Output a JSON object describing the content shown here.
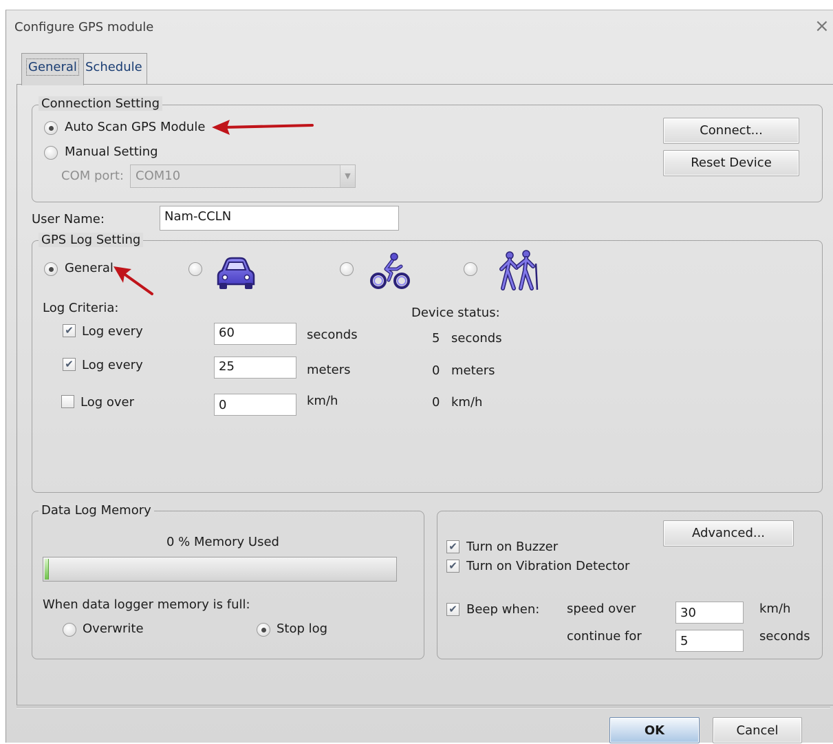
{
  "window": {
    "title": "Configure GPS module",
    "close_icon": "×"
  },
  "tabs": [
    {
      "label": "General"
    },
    {
      "label": "Schedule"
    }
  ],
  "connection": {
    "legend": "Connection Setting",
    "auto_scan": "Auto Scan GPS Module",
    "manual": "Manual Setting",
    "com_port_label": "COM port:",
    "com_port_value": "COM10",
    "connect_button": "Connect...",
    "reset_button": "Reset Device"
  },
  "user": {
    "label": "User Name:",
    "value": "Nam-CCLN"
  },
  "gps_log": {
    "legend": "GPS Log Setting",
    "general": "General",
    "modes": [
      "car-icon",
      "bicycle-icon",
      "hiking-icon"
    ],
    "log_criteria": "Log Criteria:",
    "criteria": [
      {
        "label": "Log every",
        "value": "60",
        "unit": "seconds",
        "checked": true
      },
      {
        "label": "Log every",
        "value": "25",
        "unit": "meters",
        "checked": true
      },
      {
        "label": "Log over",
        "value": "0",
        "unit": "km/h",
        "checked": false
      }
    ],
    "device_status_label": "Device status:",
    "device_status": [
      {
        "value": "5",
        "unit": "seconds"
      },
      {
        "value": "0",
        "unit": "meters"
      },
      {
        "value": "0",
        "unit": "km/h"
      }
    ]
  },
  "memory": {
    "legend": "Data Log Memory",
    "used_text": "0 % Memory Used",
    "used_percent": 0,
    "full_label": "When data logger memory is full:",
    "overwrite": "Overwrite",
    "stop_log": "Stop log"
  },
  "alerts": {
    "advanced_button": "Advanced...",
    "buzzer": "Turn on Buzzer",
    "vibration": "Turn on Vibration Detector",
    "beep_when": "Beep when:",
    "speed_over": "speed over",
    "speed_value": "30",
    "speed_unit": "km/h",
    "continue_for": "continue for",
    "continue_value": "5",
    "continue_unit": "seconds"
  },
  "footer": {
    "ok_button": "OK",
    "cancel_button": "Cancel"
  },
  "colors": {
    "arrow": "#c0141a",
    "tab_text": "#1a3d73",
    "mode_icon": "#5b4fd0"
  }
}
